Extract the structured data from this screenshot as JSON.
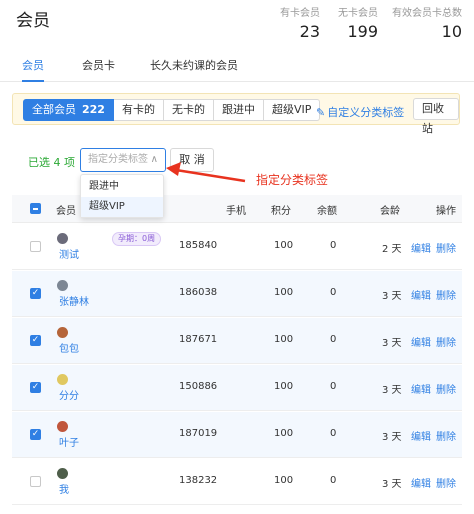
{
  "header": {
    "title": "会员",
    "stats": [
      {
        "label": "有卡会员",
        "value": "23"
      },
      {
        "label": "无卡会员",
        "value": "199"
      },
      {
        "label": "有效会员卡总数",
        "value": "10"
      }
    ]
  },
  "tabs": [
    {
      "label": "会员",
      "active": true
    },
    {
      "label": "会员卡",
      "active": false
    },
    {
      "label": "长久未约课的会员",
      "active": false
    }
  ],
  "filter": {
    "segments": [
      {
        "label": "全部会员",
        "count": "222",
        "active": true
      },
      {
        "label": "有卡的",
        "count": "",
        "active": false
      },
      {
        "label": "无卡的",
        "count": "",
        "active": false
      },
      {
        "label": "跟进中",
        "count": "",
        "active": false
      },
      {
        "label": "超级VIP",
        "count": "",
        "active": false
      }
    ],
    "custom_link": "自定义分类标签",
    "recycle_label": "回收站"
  },
  "selection": {
    "selected_text": "已选 4 项",
    "tag_select_placeholder": "指定分类标签",
    "cancel_label": "取 消",
    "dropdown_options": [
      "跟进中",
      "超级VIP"
    ],
    "highlighted_option": 1
  },
  "annotation": {
    "label": "指定分类标签",
    "color": "#e8331f"
  },
  "table": {
    "headers": {
      "member": "会员",
      "phone": "手机",
      "points": "积分",
      "balance": "余额",
      "age": "会龄",
      "actions": "操作"
    },
    "rows": [
      {
        "name": "测试",
        "badge": "孕期：0周",
        "phone": "185840",
        "points": "100",
        "balance": "0",
        "age": "2 天",
        "checked": false,
        "avatar_color": "#6b6b7a"
      },
      {
        "name": "张静林",
        "badge": "",
        "phone": "186038",
        "points": "100",
        "balance": "0",
        "age": "3 天",
        "checked": true,
        "avatar_color": "#7d8794"
      },
      {
        "name": "包包",
        "badge": "",
        "phone": "187671",
        "points": "100",
        "balance": "0",
        "age": "3 天",
        "checked": true,
        "avatar_color": "#b5653a"
      },
      {
        "name": "分分",
        "badge": "",
        "phone": "150886",
        "points": "100",
        "balance": "0",
        "age": "3 天",
        "checked": true,
        "avatar_color": "#e0c860"
      },
      {
        "name": "叶子",
        "badge": "",
        "phone": "187019",
        "points": "100",
        "balance": "0",
        "age": "3 天",
        "checked": true,
        "avatar_color": "#c0563c"
      },
      {
        "name": "我",
        "badge": "",
        "phone": "138232",
        "points": "100",
        "balance": "0",
        "age": "3 天",
        "checked": false,
        "avatar_color": "#4e5e4a"
      }
    ],
    "edit_label": "编辑",
    "delete_label": "删除"
  },
  "colors": {
    "accent": "#2f7fe3",
    "selected_count": "#2aa834",
    "filter_bar_bg": "#fff9e6"
  }
}
